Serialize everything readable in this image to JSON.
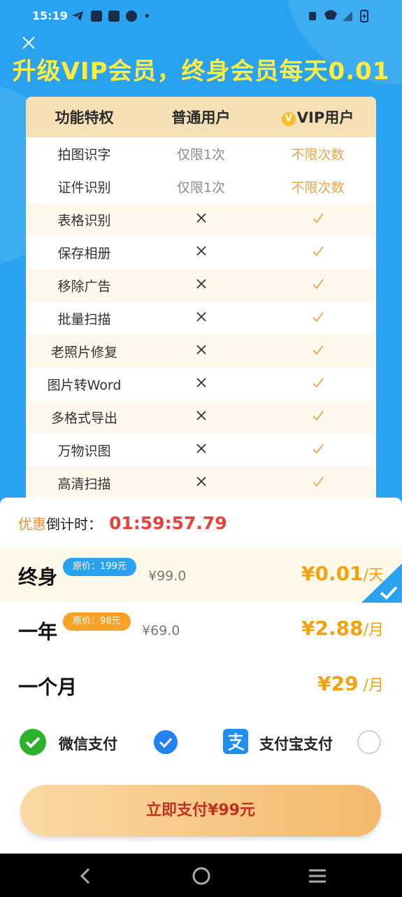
{
  "status_bar": {
    "time": "15:19",
    "dot": "•"
  },
  "headline": "升级VIP会员，终身会员每天0.01",
  "table": {
    "headers": [
      "功能特权",
      "普通用户",
      "VIP用户"
    ],
    "rows": [
      {
        "feature": "拍图识字",
        "normal": "仅限1次",
        "vip": "不限次数"
      },
      {
        "feature": "证件识别",
        "normal": "仅限1次",
        "vip": "不限次数"
      },
      {
        "feature": "表格识别",
        "normal": "×",
        "vip": "✓"
      },
      {
        "feature": "保存相册",
        "normal": "×",
        "vip": "✓"
      },
      {
        "feature": "移除广告",
        "normal": "×",
        "vip": "✓"
      },
      {
        "feature": "批量扫描",
        "normal": "×",
        "vip": "✓"
      },
      {
        "feature": "老照片修复",
        "normal": "×",
        "vip": "✓"
      },
      {
        "feature": "图片转Word",
        "normal": "×",
        "vip": "✓"
      },
      {
        "feature": "多格式导出",
        "normal": "×",
        "vip": "✓"
      },
      {
        "feature": "万物识图",
        "normal": "×",
        "vip": "✓"
      },
      {
        "feature": "高清扫描",
        "normal": "×",
        "vip": "✓"
      }
    ]
  },
  "countdown": {
    "label_highlight": "优惠",
    "label_rest": "倒计时：",
    "time": "01:59:57.79"
  },
  "plans": [
    {
      "name": "终身",
      "tag": "原价：199元",
      "strike": "¥99.0",
      "price": "¥0.01",
      "unit": "/天",
      "selected": true
    },
    {
      "name": "一年",
      "tag": "原价：98元",
      "strike": "¥69.0",
      "price": "¥2.88",
      "unit": "/月",
      "selected": false
    },
    {
      "name": "一个月",
      "tag": "",
      "strike": "",
      "price": "¥29",
      "unit": " /月",
      "selected": false
    }
  ],
  "payment": {
    "wechat_label": "微信支付",
    "alipay_label": "支付宝支付",
    "selected": "wechat"
  },
  "pay_button": "立即支付¥99元",
  "colors": {
    "brand_blue": "#29a3f0",
    "price_orange": "#f4a10e",
    "headline_yellow": "#ffec3d",
    "countdown_red": "#e8413a"
  }
}
